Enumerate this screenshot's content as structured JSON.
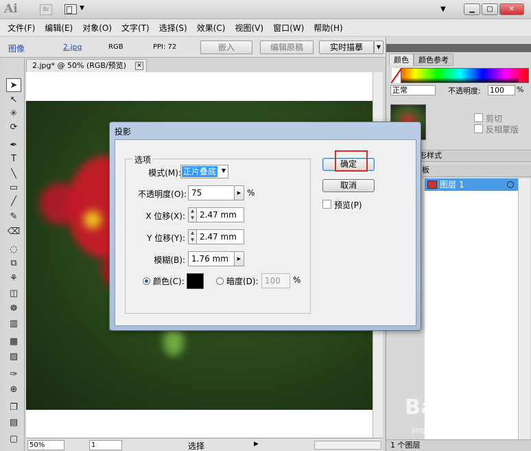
{
  "app": {
    "logo": "Ai",
    "bridge": "Br"
  },
  "window_controls": {
    "minimize": "▁",
    "restore": "□",
    "close": "✕",
    "collapse": "▼"
  },
  "menu": [
    "文件(F)",
    "编辑(E)",
    "对象(O)",
    "文字(T)",
    "选择(S)",
    "效果(C)",
    "视图(V)",
    "窗口(W)",
    "帮助(H)"
  ],
  "control_bar": {
    "object_type": "图像",
    "file_name": "2.jpg",
    "color_mode": "RGB",
    "ppi": "PPI: 72",
    "embed": "嵌入",
    "edit_original": "编辑原稿",
    "live_trace": "实时描摹",
    "trace_arrow": "▼"
  },
  "document_tab": {
    "title": "2.jpg* @ 50% (RGB/预览)",
    "close": "✕"
  },
  "status_bar": {
    "zoom": "50%",
    "page": "1",
    "label": "选择",
    "arrow": "▶"
  },
  "tools": [
    "➤",
    "↖",
    "✳",
    "⟳",
    "✒",
    "T",
    "╲",
    "▭",
    "╱",
    "✎",
    "⌫",
    "◌",
    "⧉",
    "⚘",
    "◫",
    "☸",
    "▥",
    "▦",
    "▨",
    "✑",
    "⊕",
    "❐",
    "▤",
    "▢"
  ],
  "color_panel": {
    "tabs": [
      "颜色",
      "颜色参考"
    ],
    "blend_mode": "正常",
    "opacity_label": "不透明度:",
    "opacity_value": "100",
    "percent": "%",
    "clip": "剪切",
    "invert_mask": "反相蒙版"
  },
  "graphic_styles_tab": "形样式",
  "layers_tab": "板",
  "layers": {
    "name": "图层 1",
    "footer": "1 个图层"
  },
  "dialog": {
    "title": "投影",
    "group_label": "选项",
    "mode_label": "模式(M):",
    "mode_value": "正片叠底",
    "opacity_label": "不透明度(O):",
    "opacity_value": "75",
    "x_label": "X 位移(X):",
    "x_value": "2.47 mm",
    "y_label": "Y 位移(Y):",
    "y_value": "2.47 mm",
    "blur_label": "模糊(B):",
    "blur_value": "1.76 mm",
    "color_label": "颜色(C):",
    "darkness_label": "暗度(D):",
    "darkness_value": "100",
    "percent": "%",
    "ok": "确定",
    "cancel": "取消",
    "preview": "预览(P)"
  },
  "watermark": {
    "brand": "Bai 经验",
    "url": "jingyan.baidu.com"
  }
}
